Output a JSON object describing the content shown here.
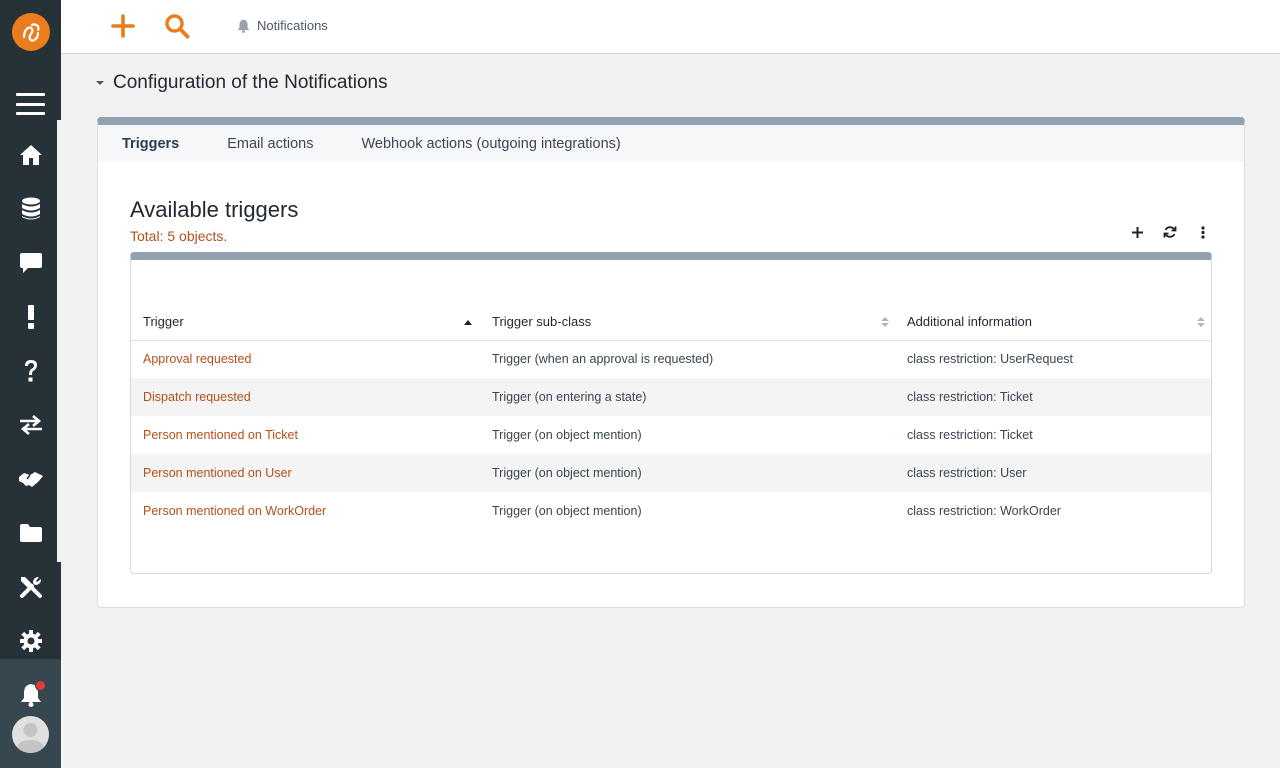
{
  "topbar": {
    "notifications_label": "Notifications"
  },
  "page": {
    "title": "Configuration of the Notifications"
  },
  "tabs": [
    {
      "label": "Triggers",
      "active": true
    },
    {
      "label": "Email actions",
      "active": false
    },
    {
      "label": "Webhook actions (outgoing integrations)",
      "active": false
    }
  ],
  "list": {
    "title": "Available triggers",
    "count": "Total: 5  objects."
  },
  "table": {
    "columns": [
      "Trigger",
      "Trigger sub-class",
      "Additional information"
    ],
    "rows": [
      [
        "Approval requested",
        "Trigger (when an approval is requested)",
        "class restriction: UserRequest"
      ],
      [
        "Dispatch requested",
        "Trigger (on entering a state)",
        "class restriction: Ticket"
      ],
      [
        "Person mentioned on Ticket",
        "Trigger (on object mention)",
        "class restriction: Ticket"
      ],
      [
        "Person mentioned on User",
        "Trigger (on object mention)",
        "class restriction: User"
      ],
      [
        "Person mentioned on WorkOrder",
        "Trigger (on object mention)",
        "class restriction: WorkOrder"
      ]
    ]
  },
  "colors": {
    "accent": "#ea7d1e",
    "link": "#b4501a",
    "sidebar": "#263238",
    "panel_border": "#93a1b2"
  },
  "icons": {
    "sidebar": [
      "home-icon",
      "database-icon",
      "chat-icon",
      "exclamation-icon",
      "question-icon",
      "transfer-icon",
      "handshake-icon",
      "folder-icon",
      "tools-icon",
      "gear-icon",
      "bell-icon"
    ],
    "topbar": [
      "plus-icon",
      "search-icon",
      "bell-icon"
    ],
    "list_actions": [
      "plus-icon",
      "refresh-icon",
      "more-vertical-icon"
    ]
  }
}
